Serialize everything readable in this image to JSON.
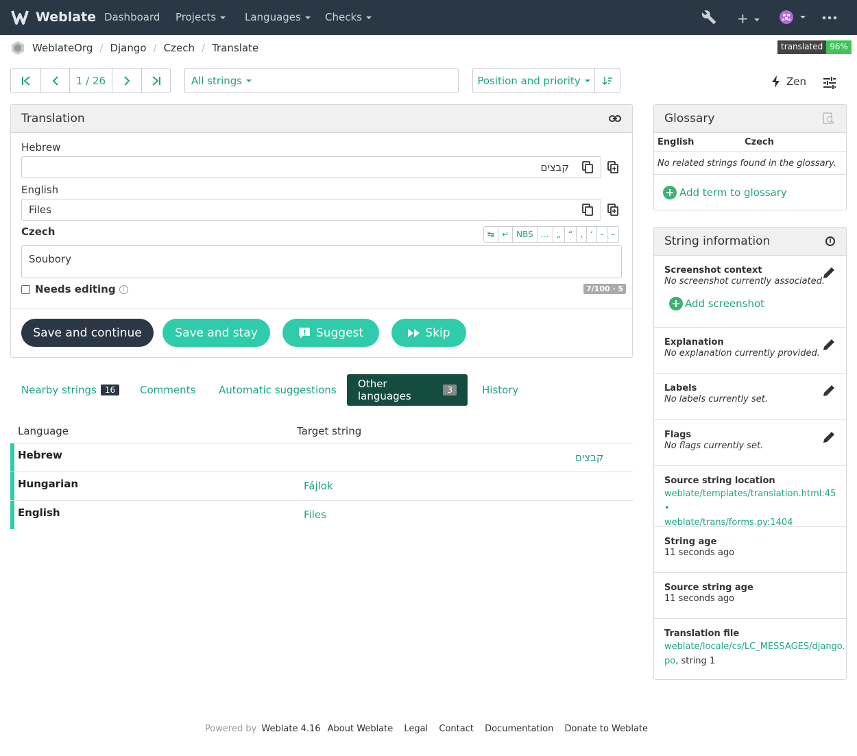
{
  "navbar": {
    "brand": "Weblate",
    "items": [
      "Dashboard",
      "Projects",
      "Languages",
      "Checks"
    ]
  },
  "breadcrumb": [
    "WeblateOrg",
    "Django",
    "Czech",
    "Translate"
  ],
  "badge": {
    "label": "translated",
    "value": "96%"
  },
  "toolbar": {
    "position": "1 / 26",
    "filter": "All strings",
    "search_value": "",
    "sort": "Position and priority",
    "zen": "Zen"
  },
  "translation": {
    "title": "Translation",
    "hebrew_label": "Hebrew",
    "hebrew_value": "קבצים",
    "english_label": "English",
    "english_value": "Files",
    "czech_label": "Czech",
    "czech_value": "Soubory",
    "chars": [
      "↹",
      "↵",
      "NBS",
      "…",
      "„",
      "“",
      "‚",
      "‘",
      "-",
      "–"
    ],
    "needs_editing": "Needs editing",
    "counter": "7/100 · 5",
    "buttons": {
      "save_continue": "Save and continue",
      "save_stay": "Save and stay",
      "suggest": "Suggest",
      "skip": "Skip"
    }
  },
  "tabs": [
    {
      "label": "Nearby strings",
      "count": "16"
    },
    {
      "label": "Comments",
      "count": ""
    },
    {
      "label": "Automatic suggestions",
      "count": ""
    },
    {
      "label": "Other languages",
      "count": "3"
    },
    {
      "label": "History",
      "count": ""
    }
  ],
  "other_languages": {
    "headers": [
      "Language",
      "Target string"
    ],
    "rows": [
      {
        "language": "Hebrew",
        "target": "קבצים"
      },
      {
        "language": "Hungarian",
        "target": "Fájlok"
      },
      {
        "language": "English",
        "target": "Files"
      }
    ]
  },
  "glossary": {
    "title": "Glossary",
    "col_source": "English",
    "col_target": "Czech",
    "empty": "No related strings found in the glossary.",
    "add": "Add term to glossary"
  },
  "string_info": {
    "title": "String information",
    "screenshot_title": "Screenshot context",
    "screenshot_value": "No screenshot currently associated.",
    "add_screenshot": "Add screenshot",
    "explanation_title": "Explanation",
    "explanation_value": "No explanation currently provided.",
    "labels_title": "Labels",
    "labels_value": "No labels currently set.",
    "flags_title": "Flags",
    "flags_value": "No flags currently set.",
    "location_title": "Source string location",
    "location_1": "weblate/templates/translation.html:45",
    "location_sep": " •",
    "location_2": "weblate/trans/forms.py:1404",
    "age_title": "String age",
    "age_value": "11 seconds ago",
    "source_age_title": "Source string age",
    "source_age_value": "11 seconds ago",
    "file_title": "Translation file",
    "file_link_1": "weblate/locale/cs/LC_MESSAGES/django.",
    "file_link_2": "po",
    "file_suffix": ", string 1"
  },
  "footer": {
    "powered": "Powered by",
    "links": [
      "Weblate 4.16",
      "About Weblate",
      "Legal",
      "Contact",
      "Documentation",
      "Donate to Weblate"
    ]
  },
  "colors": {
    "navbar": "#2a3744",
    "accent": "#1fa385",
    "primary_button": "#2a3744",
    "secondary_button": "#2eccaa",
    "active_tab": "#144d3f"
  }
}
